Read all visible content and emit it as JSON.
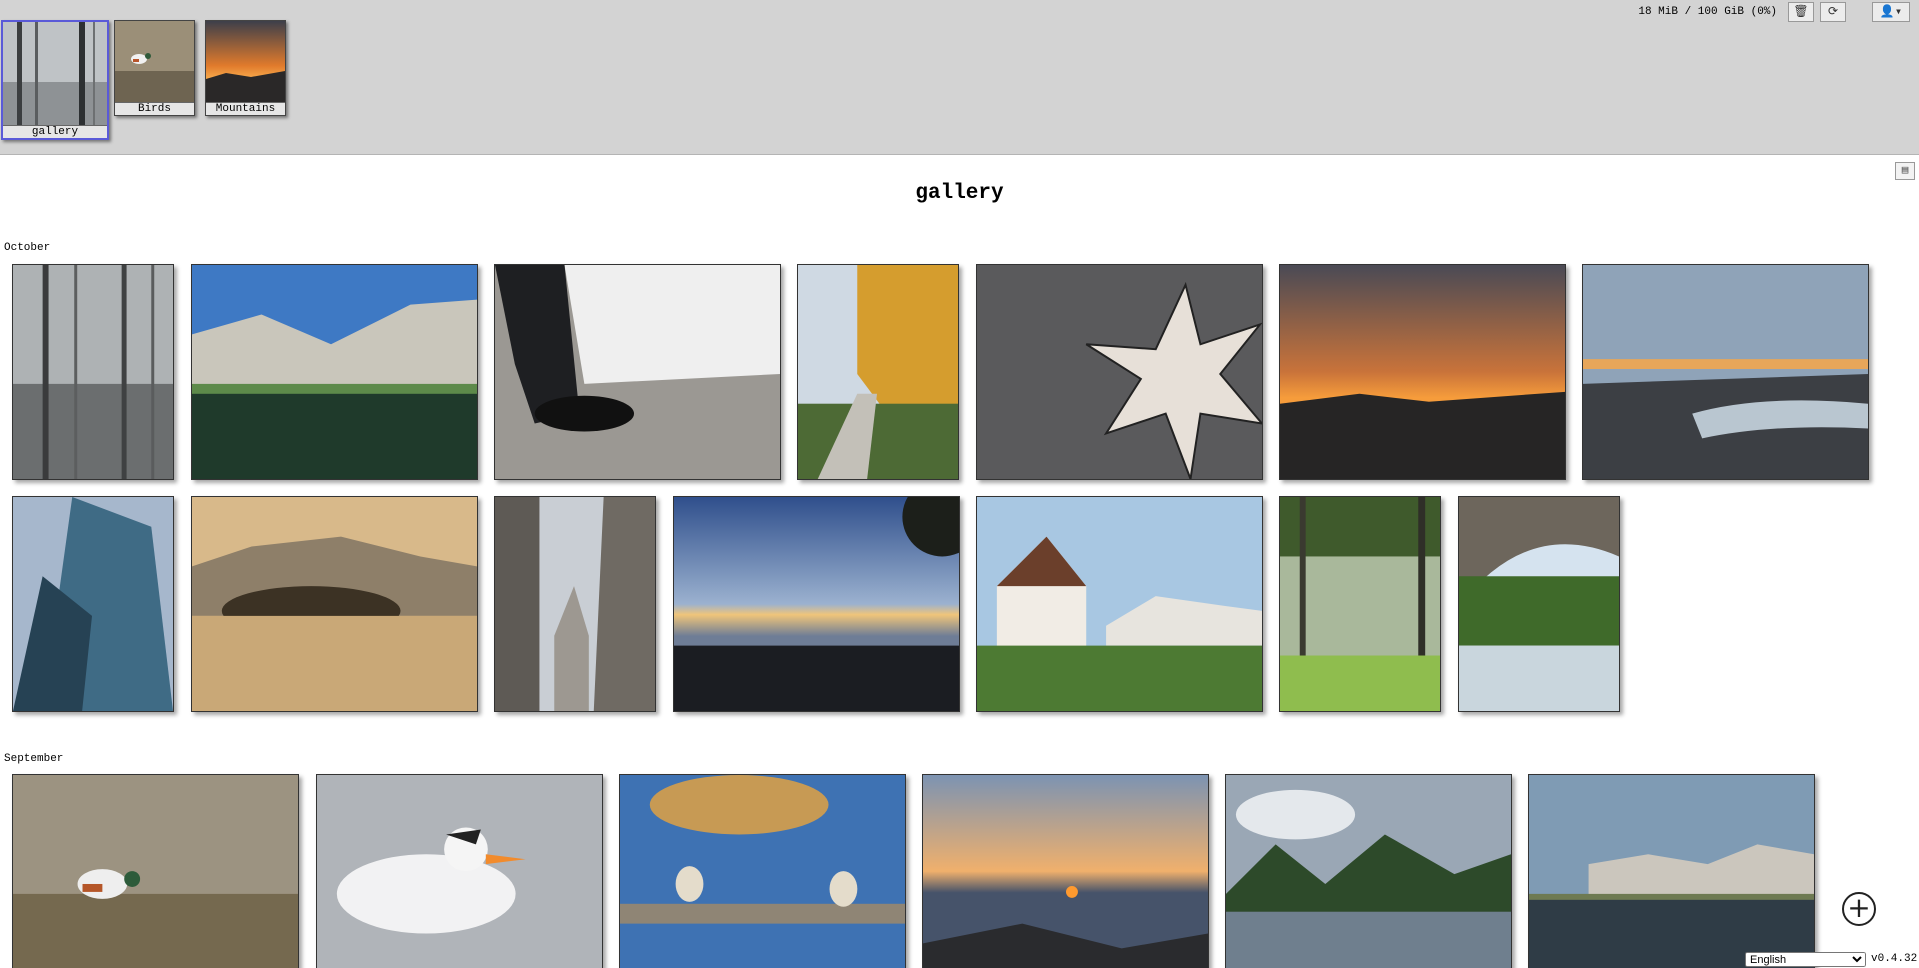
{
  "topbar": {
    "albums": [
      {
        "label": "gallery"
      },
      {
        "label": "Birds"
      },
      {
        "label": "Mountains"
      }
    ],
    "quota": "18 MiB / 100 GiB (0%)",
    "icons": {
      "trash": "🗑",
      "refresh": "⟳",
      "user": "👤▾"
    }
  },
  "gallery": {
    "title": "gallery",
    "panel_icon": "▤",
    "sections": [
      {
        "month": "October"
      },
      {
        "month": "September"
      }
    ]
  },
  "footer": {
    "add_icon": "+",
    "language_options": [
      "English"
    ],
    "language_selected": "English",
    "version": "v0.4.32"
  }
}
